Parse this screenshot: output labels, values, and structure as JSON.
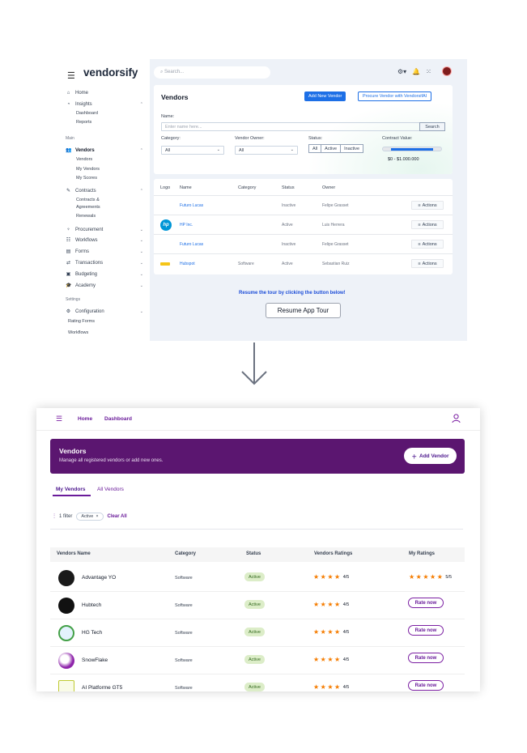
{
  "top": {
    "brand": "vendorsify",
    "search_placeholder": "Search...",
    "nav": {
      "home": "Home",
      "insights": "Insights",
      "dashboard": "Dashboard",
      "reports": "Reports",
      "main_head": "Main",
      "vendors": "Vendors",
      "vendors_sub": "Vendors",
      "my_vendors": "My Vendors",
      "my_scores": "My Scores",
      "contracts": "Contracts",
      "contracts_agreements_1": "Contracts &",
      "contracts_agreements_2": "Agreements",
      "renewals": "Renewals",
      "procurement": "Procurement",
      "workflows": "Workflows",
      "forms": "Forms",
      "transactions": "Transactions",
      "budgeting": "Budgeting",
      "academy": "Academy",
      "settings_head": "Settings",
      "configuration": "Configuration",
      "rating_forms": "Rating Forms",
      "workflows2": "Workflows"
    },
    "vendors_card": {
      "title": "Vendors",
      "add_new": "Add New Vendor",
      "procure": "Procure Vendor with VendorsifAI",
      "name_label": "Name:",
      "name_placeholder": "Enter name here...",
      "search_btn": "Search",
      "category_label": "Category:",
      "category_value": "All",
      "owner_label": "Vendor Owner:",
      "owner_value": "All",
      "status_label": "Status:",
      "status_options": [
        "All",
        "Active",
        "Inactive"
      ],
      "contract_label": "Contract Value:",
      "contract_range": "$0 - $1.000.000"
    },
    "table": {
      "headers": [
        "Logo",
        "Name",
        "Category",
        "Status",
        "Owner"
      ],
      "actions_label": "Actions",
      "rows": [
        {
          "name": "Futuro Lucas",
          "category": "",
          "status": "Inactive",
          "owner": "Felipe Grasset",
          "logo": ""
        },
        {
          "name": "HP Inc.",
          "category": "",
          "status": "Active",
          "owner": "Luis Herrera",
          "logo": "hp"
        },
        {
          "name": "Futuro Lucas",
          "category": "",
          "status": "Inactive",
          "owner": "Felipe Grasset",
          "logo": ""
        },
        {
          "name": "Hubspot",
          "category": "Software",
          "status": "Active",
          "owner": "Sebastian Ruiz",
          "logo": "hubspot"
        }
      ]
    },
    "tour_text": "Resume the tour by clicking the button below!",
    "tour_button": "Resume App Tour"
  },
  "bottom": {
    "nav": {
      "home": "Home",
      "dashboard": "Dashboard"
    },
    "banner": {
      "title": "Vendors",
      "subtitle": "Manage all registered vendors or add new ones.",
      "add_button": "Add Vendor"
    },
    "tabs": {
      "my_vendors": "My Vendors",
      "all_vendors": "All Vendors"
    },
    "filter": {
      "count": "1 filter",
      "chip": "Active",
      "clear": "Clear All"
    },
    "table": {
      "headers": [
        "Vendors Name",
        "Category",
        "Status",
        "Vendors Ratings",
        "My Ratings"
      ],
      "rate_label": "Rate now",
      "rows": [
        {
          "name": "Advantage YO",
          "category": "Software",
          "status": "Active",
          "rating": "4/5",
          "my_rating": "5/5",
          "logo_color": "#1a1a1a"
        },
        {
          "name": "Hubtech",
          "category": "Software",
          "status": "Active",
          "rating": "4/5",
          "my_rating": "",
          "logo_color": "#111111"
        },
        {
          "name": "HG Tech",
          "category": "Software",
          "status": "Active",
          "rating": "4/5",
          "my_rating": "",
          "logo_color": "#1e88e5"
        },
        {
          "name": "SnowFlake",
          "category": "Software",
          "status": "Active",
          "rating": "4/5",
          "my_rating": "",
          "logo_color": "#8e24aa"
        },
        {
          "name": "AI Platforme GT5",
          "category": "Software",
          "status": "Active",
          "rating": "4/5",
          "my_rating": "",
          "logo_color": "#c0ca33"
        }
      ]
    }
  },
  "colors": {
    "primary_blue": "#1d6fe6",
    "purple": "#5b1670",
    "star": "#f57c00",
    "active_green": "#dcedc8"
  }
}
